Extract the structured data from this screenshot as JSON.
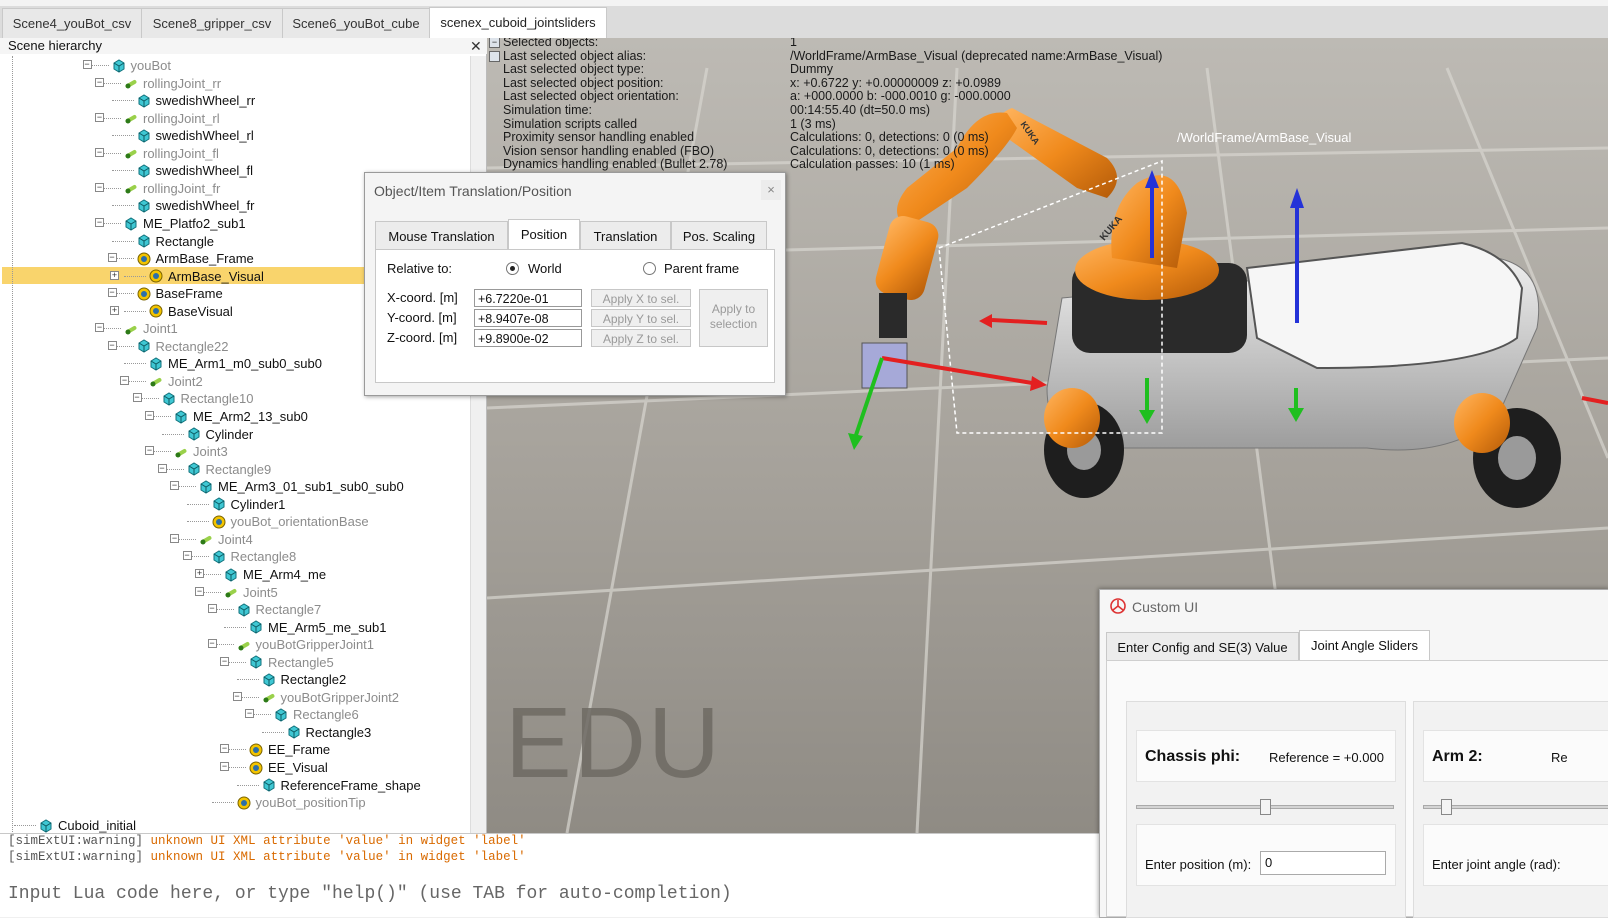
{
  "scene_tabs": [
    "Scene4_youBot_csv",
    "Scene8_gripper_csv",
    "Scene6_youBot_cube",
    "scenex_cuboid_jointsliders"
  ],
  "hierarchy": {
    "title": "Scene hierarchy",
    "close": "✕",
    "nodes": [
      {
        "label": "youBot",
        "icon": "shape-cyan-icon",
        "dim": true
      },
      {
        "label": "rollingJoint_rr",
        "icon": "joint-icon",
        "dim": true
      },
      {
        "label": "swedishWheel_rr",
        "icon": "shape-cyan-icon",
        "dim": false
      },
      {
        "label": "rollingJoint_rl",
        "icon": "joint-icon",
        "dim": true
      },
      {
        "label": "swedishWheel_rl",
        "icon": "shape-cyan-icon",
        "dim": false
      },
      {
        "label": "rollingJoint_fl",
        "icon": "joint-icon",
        "dim": true
      },
      {
        "label": "swedishWheel_fl",
        "icon": "shape-cyan-icon",
        "dim": false
      },
      {
        "label": "rollingJoint_fr",
        "icon": "joint-icon",
        "dim": true
      },
      {
        "label": "swedishWheel_fr",
        "icon": "shape-cyan-icon",
        "dim": false
      },
      {
        "label": "ME_Platfo2_sub1",
        "icon": "shape-cyan-icon",
        "dim": false
      },
      {
        "label": "Rectangle",
        "icon": "shape-cyan-icon",
        "dim": false
      },
      {
        "label": "ArmBase_Frame",
        "icon": "dummy-icon",
        "dim": false
      },
      {
        "label": "ArmBase_Visual",
        "icon": "dummy-icon",
        "dim": false
      },
      {
        "label": "BaseFrame",
        "icon": "dummy-icon",
        "dim": false
      },
      {
        "label": "BaseVisual",
        "icon": "dummy-icon",
        "dim": false
      },
      {
        "label": "Joint1",
        "icon": "joint-icon",
        "dim": true
      },
      {
        "label": "Rectangle22",
        "icon": "shape-cyan-icon",
        "dim": true
      },
      {
        "label": "ME_Arm1_m0_sub0_sub0",
        "icon": "shape-cyan-icon",
        "dim": false
      },
      {
        "label": "Joint2",
        "icon": "joint-icon",
        "dim": true
      },
      {
        "label": "Rectangle10",
        "icon": "shape-cyan-icon",
        "dim": true
      },
      {
        "label": "ME_Arm2_13_sub0",
        "icon": "shape-cyan-icon",
        "dim": false
      },
      {
        "label": "Cylinder",
        "icon": "shape-cyan-icon",
        "dim": false
      },
      {
        "label": "Joint3",
        "icon": "joint-icon",
        "dim": true
      },
      {
        "label": "Rectangle9",
        "icon": "shape-cyan-icon",
        "dim": true
      },
      {
        "label": "ME_Arm3_01_sub1_sub0_sub0",
        "icon": "shape-cyan-icon",
        "dim": false
      },
      {
        "label": "Cylinder1",
        "icon": "shape-cyan-icon",
        "dim": false
      },
      {
        "label": "youBot_orientationBase",
        "icon": "dummy-icon",
        "dim": true
      },
      {
        "label": "Joint4",
        "icon": "joint-icon",
        "dim": true
      },
      {
        "label": "Rectangle8",
        "icon": "shape-cyan-icon",
        "dim": true
      },
      {
        "label": "ME_Arm4_me",
        "icon": "shape-cyan-icon",
        "dim": false
      },
      {
        "label": "Joint5",
        "icon": "joint-icon",
        "dim": true
      },
      {
        "label": "Rectangle7",
        "icon": "shape-cyan-icon",
        "dim": true
      },
      {
        "label": "ME_Arm5_me_sub1",
        "icon": "shape-cyan-icon",
        "dim": false
      },
      {
        "label": "youBotGripperJoint1",
        "icon": "joint-icon",
        "dim": true
      },
      {
        "label": "Rectangle5",
        "icon": "shape-cyan-icon",
        "dim": true
      },
      {
        "label": "Rectangle2",
        "icon": "shape-cyan-icon",
        "dim": false
      },
      {
        "label": "youBotGripperJoint2",
        "icon": "joint-icon",
        "dim": true
      },
      {
        "label": "Rectangle6",
        "icon": "shape-cyan-icon",
        "dim": true
      },
      {
        "label": "Rectangle3",
        "icon": "shape-cyan-icon",
        "dim": false
      },
      {
        "label": "EE_Frame",
        "icon": "dummy-icon",
        "dim": false
      },
      {
        "label": "EE_Visual",
        "icon": "dummy-icon",
        "dim": false
      },
      {
        "label": "ReferenceFrame_shape",
        "icon": "shape-cyan-icon",
        "dim": false
      },
      {
        "label": "youBot_positionTip",
        "icon": "dummy-icon",
        "dim": true
      },
      {
        "label": "Cuboid_initial",
        "icon": "shape-cyan-icon",
        "dim": false
      }
    ]
  },
  "info": {
    "rows": [
      {
        "k": "Selected objects:",
        "v": "1"
      },
      {
        "k": "Last selected object alias:",
        "v": "/WorldFrame/ArmBase_Visual   (deprecated name:ArmBase_Visual)"
      },
      {
        "k": "Last selected object type:",
        "v": "Dummy"
      },
      {
        "k": "Last selected object position:",
        "v": "x: +0.6722   y: +0.00000009   z: +0.0989"
      },
      {
        "k": "Last selected object orientation:",
        "v": "a: +000.0000   b: -000.0010   g: -000.0000"
      },
      {
        "k": "Simulation time:",
        "v": "00:14:55.40 (dt=50.0 ms)"
      },
      {
        "k": "Simulation scripts called",
        "v": "1 (3 ms)"
      },
      {
        "k": "Proximity sensor handling enabled",
        "v": "Calculations: 0, detections: 0 (0 ms)"
      },
      {
        "k": "Vision sensor handling enabled (FBO)",
        "v": "Calculations: 0, detections: 0 (0 ms)"
      },
      {
        "k": "Dynamics handling enabled (Bullet 2.78)",
        "v": "Calculation passes: 10 (1 ms)"
      }
    ]
  },
  "viewport": {
    "object_label": "/WorldFrame/ArmBase_Visual",
    "watermark": "EDU",
    "arm_text": "KUKA"
  },
  "dialog": {
    "title": "Object/Item Translation/Position",
    "close": "×",
    "tabs": [
      "Mouse Translation",
      "Position",
      "Translation",
      "Pos. Scaling"
    ],
    "relative_to": "Relative to:",
    "world": "World",
    "parent": "Parent frame",
    "x_label": "X-coord. [m]",
    "y_label": "Y-coord. [m]",
    "z_label": "Z-coord. [m]",
    "x_value": "+6.7220e-01",
    "y_value": "+8.9407e-08",
    "z_value": "+9.8900e-02",
    "apply_x": "Apply X to sel.",
    "apply_y": "Apply Y to sel.",
    "apply_z": "Apply Z to sel.",
    "apply_line1": "Apply to",
    "apply_line2": "selection"
  },
  "console": {
    "lines": [
      {
        "prefix": "[simExtUI:warning]",
        "msg": "unknown UI XML attribute 'value' in widget 'label'"
      },
      {
        "prefix": "[simExtUI:warning]",
        "msg": "unknown UI XML attribute 'value' in widget 'label'"
      }
    ],
    "input_placeholder": "Input Lua code here, or type \"help()\" (use TAB for auto-completion)"
  },
  "custom_ui": {
    "title": "Custom UI",
    "tabs": [
      "Enter Config and SE(3) Value",
      "Joint Angle Sliders"
    ],
    "chassis_title": "Chassis phi:",
    "chassis_ref": "Reference = +0.000",
    "chassis_slider": 0.5,
    "chassis_enter": "Enter position (m):",
    "chassis_value": "0",
    "arm_title": "Arm 2:",
    "arm_ref": "Re",
    "arm_slider": 0.1,
    "arm_enter": "Enter joint angle (rad):"
  }
}
